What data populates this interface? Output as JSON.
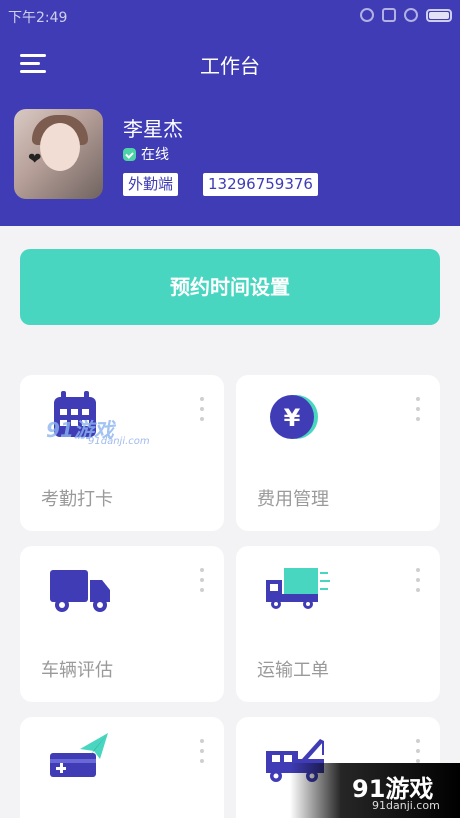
{
  "status_bar": {
    "time": "下午2:49"
  },
  "header": {
    "title": "工作台"
  },
  "profile": {
    "name": "李星杰",
    "status": "在线",
    "role": "外勤端",
    "phone": "13296759376"
  },
  "reserve_button": {
    "label": "预约时间设置"
  },
  "grid": {
    "items": [
      {
        "label": "考勤打卡",
        "icon": "calendar-icon"
      },
      {
        "label": "费用管理",
        "icon": "yen-coin-icon"
      },
      {
        "label": "车辆评估",
        "icon": "truck-icon"
      },
      {
        "label": "运输工单",
        "icon": "fast-delivery-truck-icon"
      },
      {
        "label": "",
        "icon": "card-send-icon"
      },
      {
        "label": "",
        "icon": "crane-truck-icon"
      }
    ]
  },
  "watermark": {
    "text": "91游戏",
    "domain": "91danji.com"
  },
  "colors": {
    "primary": "#3f3cb6",
    "accent": "#49d6c0",
    "background": "#f3f3f6"
  }
}
